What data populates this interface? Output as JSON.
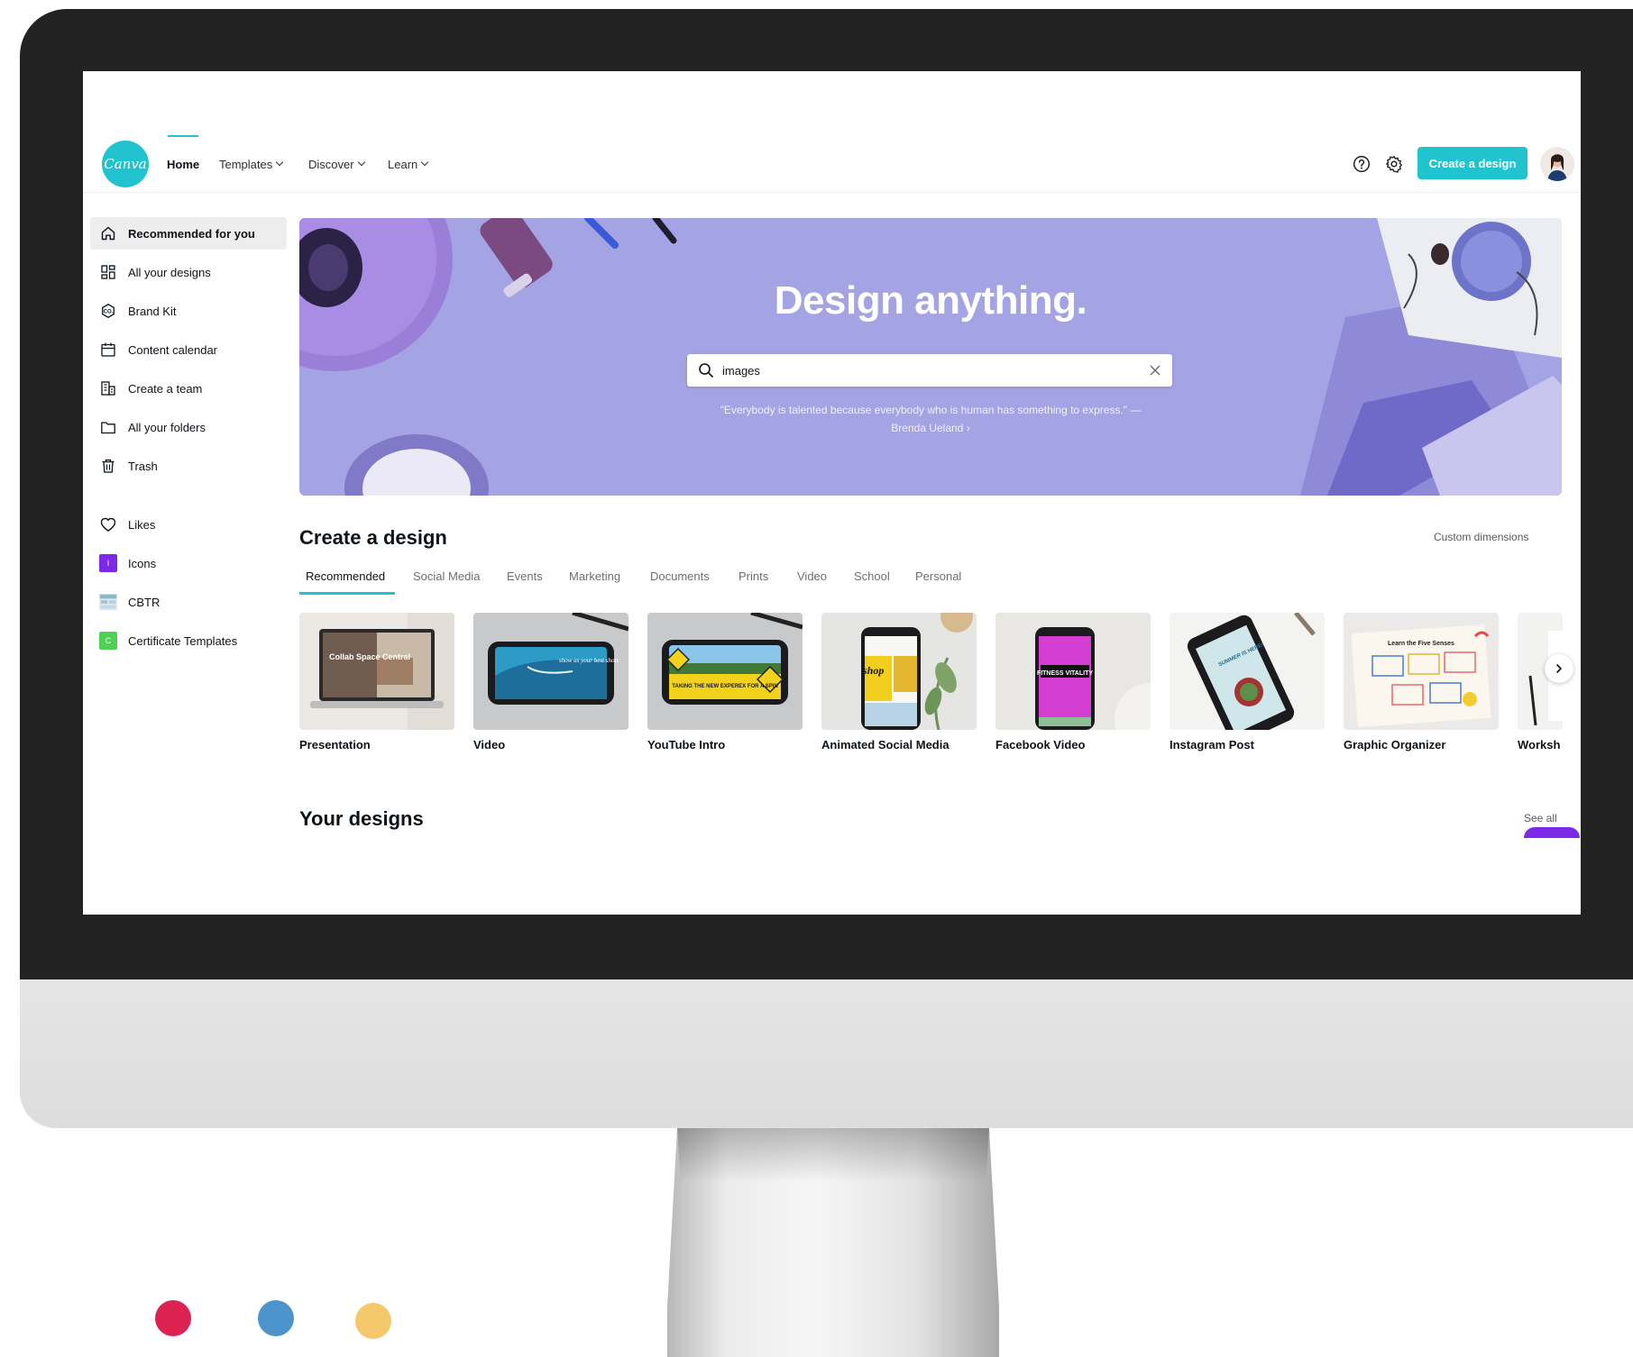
{
  "colors": {
    "accent": "#21c3cf",
    "create_button": "#1fc4cf",
    "hero_bg": "#a4a3e3",
    "dot_red": "#dc2251",
    "dot_blue": "#4e94cc",
    "dot_yellow": "#f5c96b"
  },
  "header": {
    "logo_text": "Canva",
    "nav": [
      {
        "label": "Home",
        "active": true
      },
      {
        "label": "Templates",
        "dropdown": true
      },
      {
        "label": "Discover",
        "dropdown": true
      },
      {
        "label": "Learn",
        "dropdown": true
      }
    ],
    "icons": [
      "help-icon",
      "settings-icon"
    ],
    "create_button": "Create a design"
  },
  "sidebar": {
    "items": [
      {
        "label": "Recommended for you",
        "icon": "home-icon",
        "active": true
      },
      {
        "label": "All your designs",
        "icon": "grid-icon"
      },
      {
        "label": "Brand Kit",
        "icon": "brand-kit-icon"
      },
      {
        "label": "Content calendar",
        "icon": "calendar-icon"
      },
      {
        "label": "Create a team",
        "icon": "team-icon"
      },
      {
        "label": "All your folders",
        "icon": "folder-icon"
      },
      {
        "label": "Trash",
        "icon": "trash-icon"
      }
    ],
    "folders": [
      {
        "label": "Likes",
        "icon": "heart-icon"
      },
      {
        "label": "Icons",
        "icon": "folder-square-icon",
        "badge": "I",
        "color": "#7d2ae8"
      },
      {
        "label": "CBTR",
        "icon": "folder-thumbnail-icon"
      },
      {
        "label": "Certificate Templates",
        "icon": "folder-square-icon",
        "badge": "C",
        "color": "#4fd154"
      }
    ]
  },
  "hero": {
    "title": "Design anything.",
    "search_value": "images",
    "quote": "\"Everybody is talented because everybody who is human has something to express.\" —",
    "quote_author": "Brenda Ueland ›"
  },
  "create_section": {
    "title": "Create a design",
    "custom_dimensions": "Custom dimensions",
    "tabs": [
      "Recommended",
      "Social Media",
      "Events",
      "Marketing",
      "Documents",
      "Prints",
      "Video",
      "School",
      "Personal"
    ],
    "cards": [
      {
        "label": "Presentation",
        "thumb_text": "Collab Space Central"
      },
      {
        "label": "Video",
        "thumb_text": "show us your best shots"
      },
      {
        "label": "YouTube Intro",
        "thumb_text": "TAKING THE NEW EXPEREX FOR A SPIN"
      },
      {
        "label": "Animated Social Media",
        "thumb_text": "shop"
      },
      {
        "label": "Facebook Video",
        "thumb_text": "FITNESS VITALITY"
      },
      {
        "label": "Instagram Post",
        "thumb_text": "SUMMER IS HERE!"
      },
      {
        "label": "Graphic Organizer",
        "thumb_text": "Learn the Five Senses"
      },
      {
        "label": "Worksh"
      }
    ]
  },
  "designs_section": {
    "title": "Your designs",
    "see_all": "See all"
  }
}
